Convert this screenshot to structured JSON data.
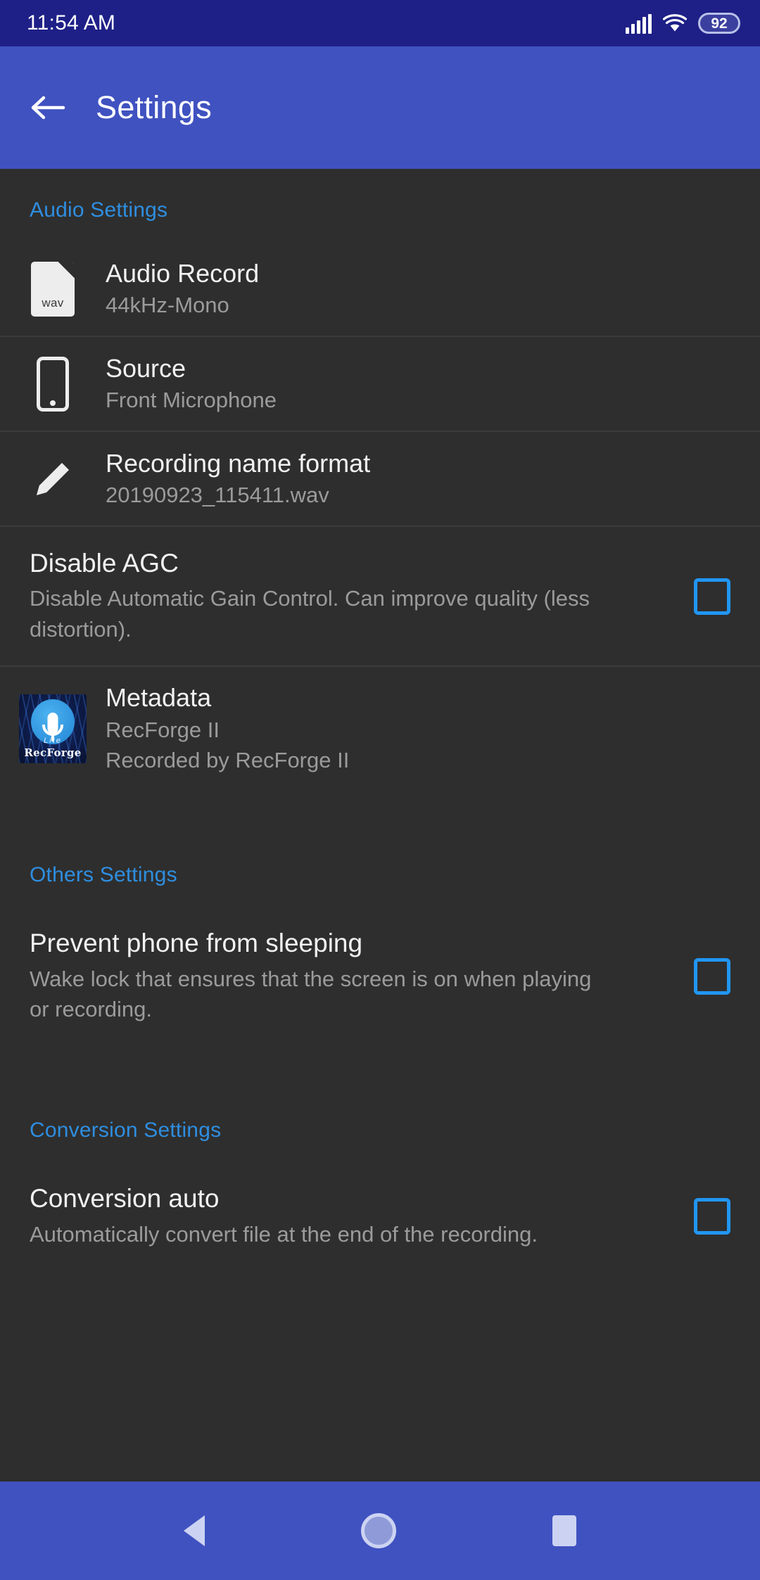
{
  "status_bar": {
    "time": "11:54 AM",
    "battery_level": "92",
    "signal_icon": "signal-bars-icon",
    "wifi_icon": "wifi-icon",
    "battery_icon": "battery-icon"
  },
  "app_bar": {
    "back_icon": "back-arrow-icon",
    "title": "Settings"
  },
  "colors": {
    "status_bar_bg": "#1e2087",
    "app_bar_bg": "#4052c0",
    "content_bg": "#2e2e2e",
    "section_header": "#2e8ee0",
    "checkbox_accent": "#2196f3",
    "primary_text": "#f2f2f2",
    "secondary_text": "#9b9b9b"
  },
  "sections": {
    "audio": {
      "header": "Audio Settings",
      "rows": [
        {
          "icon": "wav-file-icon",
          "icon_label": "wav",
          "title": "Audio Record",
          "subtitle": "44kHz-Mono"
        },
        {
          "icon": "smartphone-icon",
          "title": "Source",
          "subtitle": "Front Microphone"
        },
        {
          "icon": "pencil-edit-icon",
          "title": "Recording name format",
          "subtitle": "20190923_115411.wav"
        }
      ],
      "agc": {
        "title": "Disable AGC",
        "subtitle": "Disable Automatic Gain Control. Can improve quality (less distortion).",
        "checked": false
      },
      "metadata": {
        "icon": "recforge-app-icon",
        "icon_brand": "RecForge",
        "icon_edition": "Lite",
        "title": "Metadata",
        "subtitle_1": "RecForge II",
        "subtitle_2": "Recorded by RecForge II"
      }
    },
    "others": {
      "header": "Others Settings",
      "prevent_sleep": {
        "title": "Prevent phone from sleeping",
        "subtitle": "Wake lock that ensures that the screen is on when playing or recording.",
        "checked": false
      }
    },
    "conversion": {
      "header": "Conversion Settings",
      "conversion_auto": {
        "title": "Conversion auto",
        "subtitle": "Automatically convert file at the end of the recording.",
        "checked": false
      }
    }
  },
  "nav_bar": {
    "back_icon": "nav-back-icon",
    "home_icon": "nav-home-icon",
    "recents_icon": "nav-recents-icon"
  }
}
